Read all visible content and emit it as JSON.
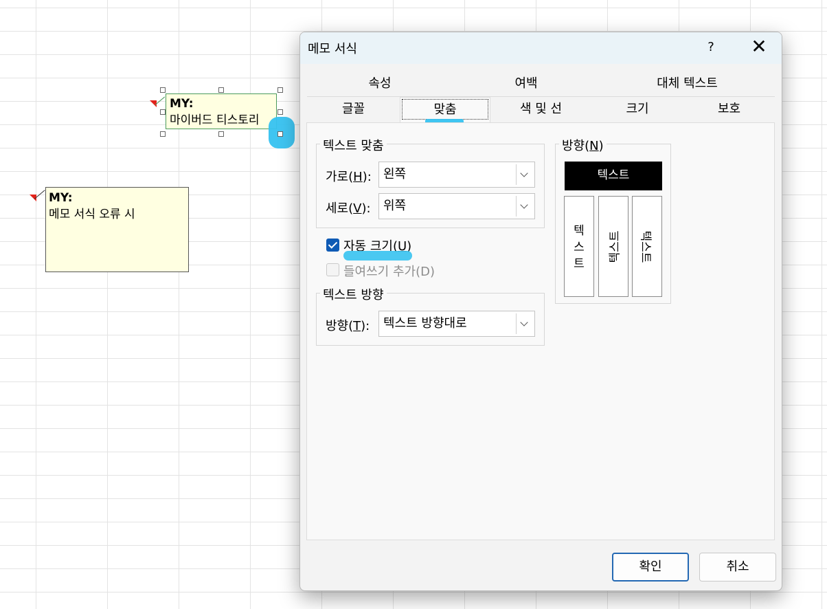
{
  "sheet": {
    "comment1": {
      "author": "MY:",
      "text": "마이버드 티스토리"
    },
    "comment2": {
      "author": "MY:",
      "text": "메모 서식 오류 시"
    }
  },
  "dialog": {
    "title": "메모 서식",
    "help_label": "?",
    "close_label": "✕",
    "tabs_row1": [
      "속성",
      "여백",
      "대체 텍스트"
    ],
    "tabs_row2": [
      "글꼴",
      "맞춤",
      "색 및 선",
      "크기",
      "보호"
    ],
    "active_tab": "맞춤",
    "text_align": {
      "group_label": "텍스트 맞춤",
      "horizontal_label": "가로(",
      "horizontal_key": "H",
      "horizontal_label_end": "):",
      "horizontal_value": "왼쪽",
      "vertical_label": "세로(",
      "vertical_key": "V",
      "vertical_label_end": "):",
      "vertical_value": "위쪽"
    },
    "auto_size": {
      "label": "자동 크기(",
      "key": "U",
      "label_end": ")",
      "checked": true
    },
    "indent": {
      "label": "들여쓰기 추가(D)",
      "checked": false,
      "enabled": false
    },
    "text_direction": {
      "group_label": "텍스트 방향",
      "direction_label": "방향(",
      "direction_key": "T",
      "direction_label_end": "):",
      "direction_value": "텍스트 방향대로"
    },
    "orientation": {
      "group_label": "방향(",
      "group_key": "N",
      "group_label_end": ")",
      "horizontal_text": "텍스트",
      "stacked_chars": [
        "텍",
        "스",
        "트"
      ],
      "rotated_up_text": "텍스트",
      "rotated_down_text": "텍스트"
    },
    "ok_label": "확인",
    "cancel_label": "취소"
  },
  "colors": {
    "highlight": "#36c2f0",
    "comment_bg": "#ffffe1",
    "checkbox": "#0f5bb5",
    "primary_border": "#2368b3"
  }
}
